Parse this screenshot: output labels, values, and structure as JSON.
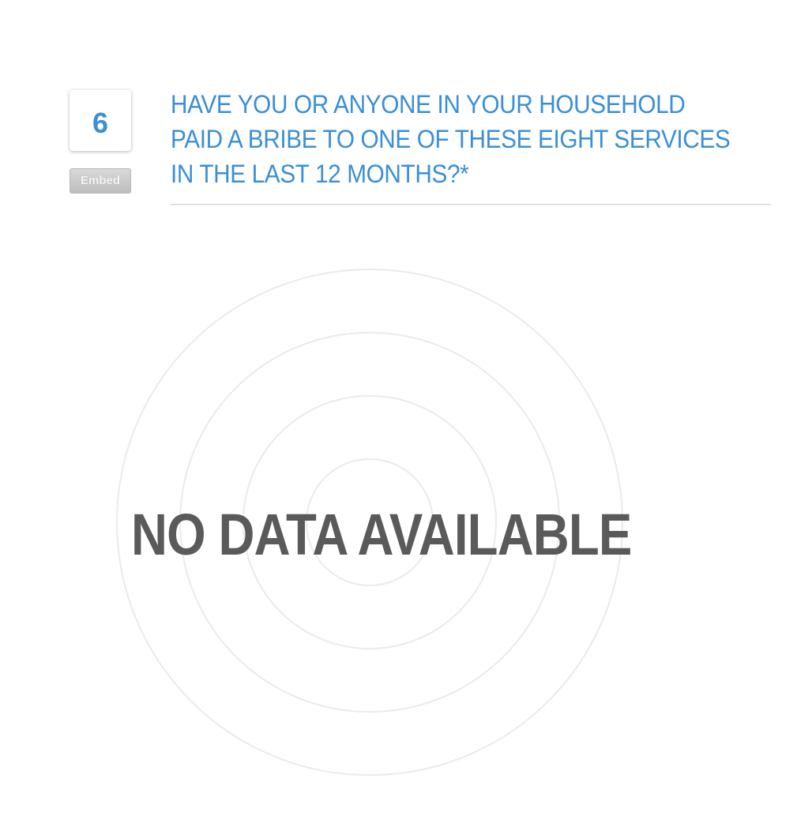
{
  "question": {
    "number": "6",
    "title": "HAVE YOU OR ANYONE IN YOUR HOUSEHOLD PAID A BRIBE TO ONE OF THESE EIGHT SERVICES IN THE LAST 12 MONTHS?*"
  },
  "embed_button": {
    "label": "Embed"
  },
  "chart": {
    "empty_message": "NO DATA AVAILABLE",
    "ring_color": "#ebebeb"
  },
  "colors": {
    "accent": "#3a8fd6",
    "empty_text": "#5a5a5a"
  }
}
